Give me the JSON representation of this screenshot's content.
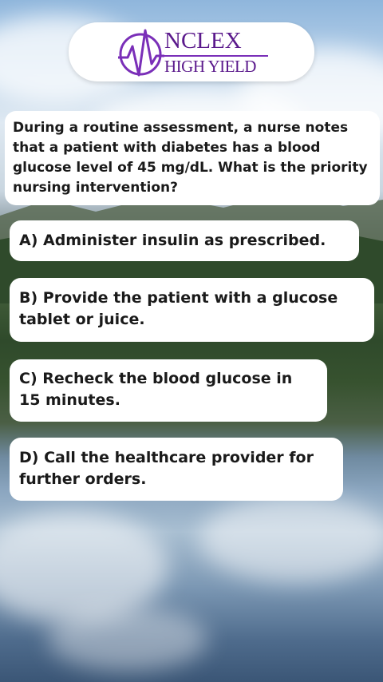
{
  "brand": {
    "line1": "NCLEX",
    "line2": "HIGH YIELD",
    "icon": "heartbeat-icon",
    "color": "#5b1a8c"
  },
  "question": {
    "text": "During a routine assessment, a nurse notes that a patient with diabetes has a blood glucose level of 45 mg/dL. What is the priority nursing intervention?"
  },
  "options": [
    "A) Administer insulin as prescribed.",
    "B) Provide the patient with a glucose tablet or juice.",
    "C) Recheck the blood glucose in 15 minutes.",
    "D) Call the healthcare provider for further orders."
  ]
}
